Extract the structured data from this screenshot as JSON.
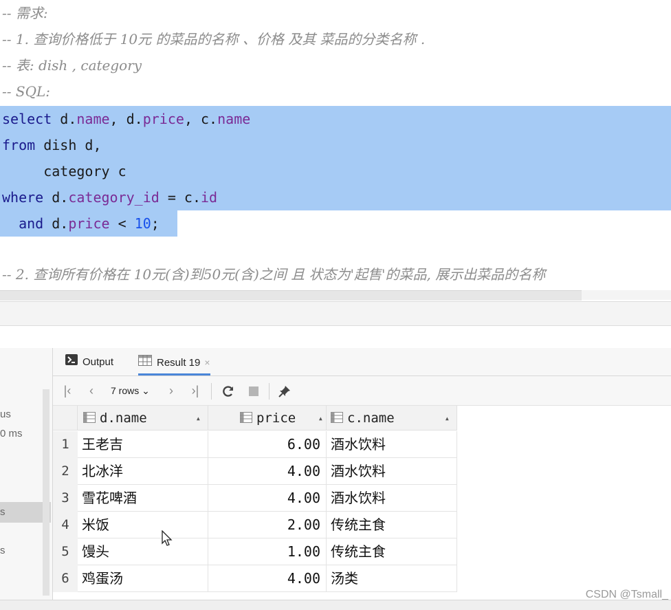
{
  "editor": {
    "comments": [
      "-- 需求:",
      "-- 1. 查询价格低于 10元 的菜品的名称 、价格 及其 菜品的分类名称 .",
      "-- 表: dish , category",
      "-- SQL:"
    ],
    "sql": {
      "l1_kw": "select",
      "l1_a": " d.",
      "l1_f1": "name",
      "l1_b": ", d.",
      "l1_f2": "price",
      "l1_c": ", c.",
      "l1_f3": "name",
      "l2_kw": "from",
      "l2_a": " dish d,",
      "l3_a": "     category c",
      "l4_kw": "where",
      "l4_a": " d.",
      "l4_f": "category_id",
      "l4_b": " = c.",
      "l4_f2": "id",
      "l5_kw": "  and",
      "l5_a": " d.",
      "l5_f": "price",
      "l5_b": " < ",
      "l5_n": "10",
      "l5_c": ";"
    },
    "comment2": "-- 2. 查询所有价格在 10元(含)到50元(含)之间 且 状态为'起售'的菜品, 展示出菜品的名称"
  },
  "services": {
    "t1": "us",
    "t2": "0 ms",
    "t3": "s",
    "t4": "s"
  },
  "panel": {
    "tabs": [
      {
        "label": "Output",
        "icon": "output-icon"
      },
      {
        "label": "Result 19",
        "icon": "table-icon",
        "close": "×"
      }
    ],
    "toolbar": {
      "rows_label": "7 rows",
      "rows_caret": "⌄"
    },
    "columns": [
      "d.name",
      "price",
      "c.name"
    ],
    "rows": [
      {
        "n": "1",
        "name": "王老吉",
        "price": "6.00",
        "cname": "酒水饮料"
      },
      {
        "n": "2",
        "name": "北冰洋",
        "price": "4.00",
        "cname": "酒水饮料"
      },
      {
        "n": "3",
        "name": "雪花啤酒",
        "price": "4.00",
        "cname": "酒水饮料"
      },
      {
        "n": "4",
        "name": "米饭",
        "price": "2.00",
        "cname": "传统主食"
      },
      {
        "n": "5",
        "name": "馒头",
        "price": "1.00",
        "cname": "传统主食"
      },
      {
        "n": "6",
        "name": "鸡蛋汤",
        "price": "4.00",
        "cname": "汤类"
      }
    ]
  },
  "watermark": "CSDN @Tsmall_"
}
